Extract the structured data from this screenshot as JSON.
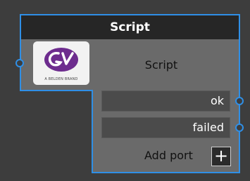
{
  "node": {
    "title": "Script",
    "label": "Script",
    "logo": {
      "icon": "grass-valley-logo-icon",
      "caption": "A BELDEN BRAND",
      "brand_color": "#6d2c8e"
    },
    "ports": [
      {
        "label": "ok"
      },
      {
        "label": "failed"
      }
    ],
    "add_port_label": "Add port",
    "add_port_button": "+"
  },
  "colors": {
    "accent": "#2f8fe6",
    "header_bg": "#262626",
    "body_bg": "#6a6a6a",
    "field_bg": "#4b4b4b",
    "canvas_bg": "#3d3d3d"
  }
}
